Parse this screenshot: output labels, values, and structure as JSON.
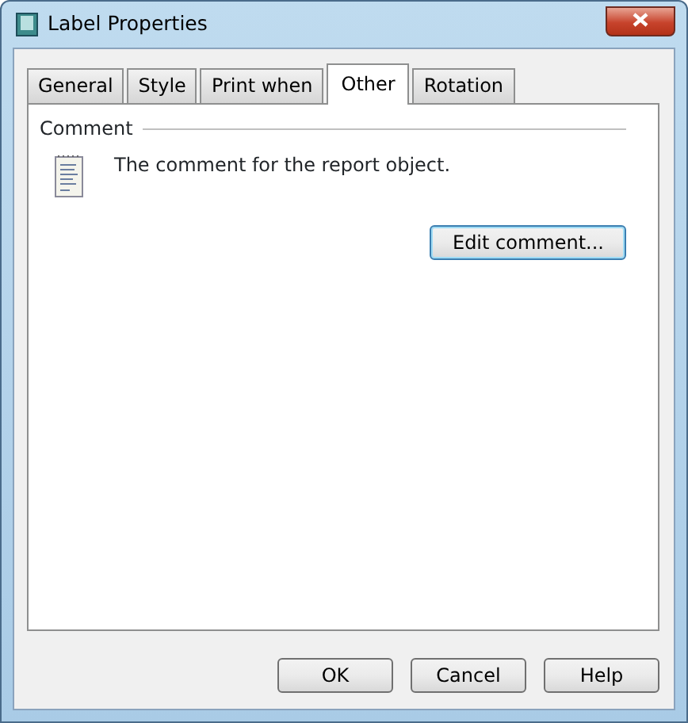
{
  "window": {
    "title": "Label Properties"
  },
  "tabs": [
    {
      "label": "General",
      "selected": false
    },
    {
      "label": "Style",
      "selected": false
    },
    {
      "label": "Print when",
      "selected": false
    },
    {
      "label": "Other",
      "selected": true
    },
    {
      "label": "Rotation",
      "selected": false
    }
  ],
  "comment": {
    "heading": "Comment",
    "text": "The comment for the report object.",
    "button": "Edit comment..."
  },
  "buttons": [
    "OK",
    "Cancel",
    "Help"
  ]
}
